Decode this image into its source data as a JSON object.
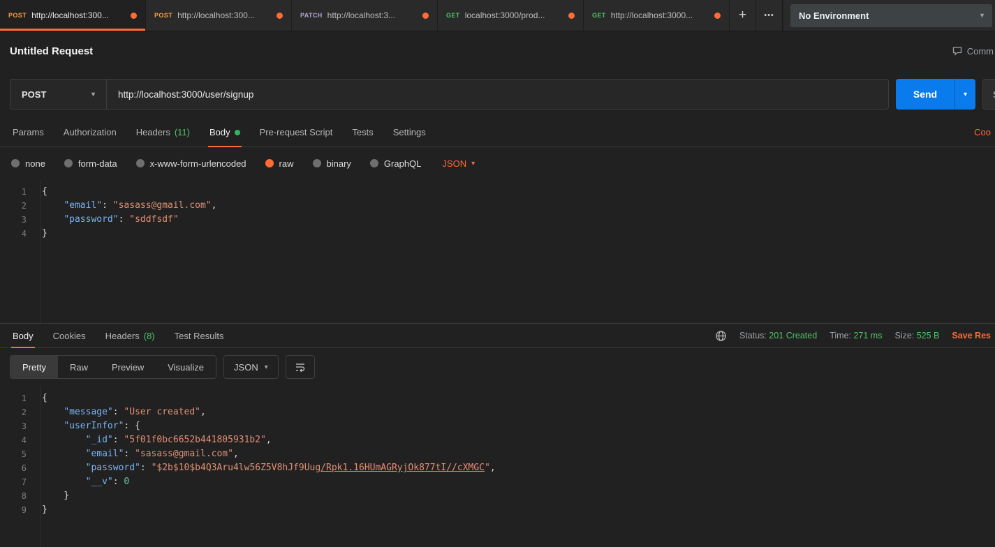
{
  "colors": {
    "accent": "#ff6c37",
    "green": "#4fc368",
    "blue": "#097bed",
    "methods": {
      "GET": "#4fc368",
      "POST": "#f59b42",
      "PATCH": "#b5a1d6"
    }
  },
  "icons": {
    "new_tab": "+",
    "more_tabs": "•••",
    "chevron_down": "▾"
  },
  "top_bar": {
    "tabs": [
      {
        "method": "POST",
        "title": "http://localhost:300...",
        "active": true,
        "unsaved": true
      },
      {
        "method": "POST",
        "title": "http://localhost:300...",
        "active": false,
        "unsaved": true
      },
      {
        "method": "PATCH",
        "title": "http://localhost:3...",
        "active": false,
        "unsaved": true
      },
      {
        "method": "GET",
        "title": "localhost:3000/prod...",
        "active": false,
        "unsaved": true
      },
      {
        "method": "GET",
        "title": "http://localhost:3000...",
        "active": false,
        "unsaved": true
      }
    ],
    "environment": {
      "selected": "No Environment"
    }
  },
  "request": {
    "title": "Untitled Request",
    "comment_label": "Comm",
    "method": "POST",
    "url": "http://localhost:3000/user/signup",
    "send_label": "Send",
    "save_label": "S",
    "cookies_label": "Coo",
    "language": "JSON",
    "nav_tabs": [
      {
        "label": "Params"
      },
      {
        "label": "Authorization"
      },
      {
        "label": "Headers",
        "count": "(11)"
      },
      {
        "label": "Body",
        "active": true,
        "dot": true
      },
      {
        "label": "Pre-request Script"
      },
      {
        "label": "Tests"
      },
      {
        "label": "Settings"
      }
    ],
    "body_modes": [
      {
        "label": "none"
      },
      {
        "label": "form-data"
      },
      {
        "label": "x-www-form-urlencoded"
      },
      {
        "label": "raw",
        "selected": true
      },
      {
        "label": "binary"
      },
      {
        "label": "GraphQL"
      }
    ],
    "editor_lines": [
      {
        "segs": [
          {
            "t": "{",
            "c": "punc"
          }
        ]
      },
      {
        "segs": [
          {
            "t": "    ",
            "c": "plain"
          },
          {
            "t": "\"email\"",
            "c": "key"
          },
          {
            "t": ": ",
            "c": "punc"
          },
          {
            "t": "\"sasass@gmail.com\"",
            "c": "str"
          },
          {
            "t": ",",
            "c": "punc"
          }
        ]
      },
      {
        "segs": [
          {
            "t": "    ",
            "c": "plain"
          },
          {
            "t": "\"password\"",
            "c": "key"
          },
          {
            "t": ": ",
            "c": "punc"
          },
          {
            "t": "\"sddfsdf\"",
            "c": "str"
          }
        ]
      },
      {
        "segs": [
          {
            "t": "}",
            "c": "punc"
          }
        ]
      }
    ]
  },
  "response": {
    "nav_tabs": [
      {
        "label": "Body",
        "active": true
      },
      {
        "label": "Cookies"
      },
      {
        "label": "Headers",
        "count": "(8)"
      },
      {
        "label": "Test Results"
      }
    ],
    "meta": [
      {
        "label": "Status:",
        "value": "201 Created"
      },
      {
        "label": "Time:",
        "value": "271 ms"
      },
      {
        "label": "Size:",
        "value": "525 B"
      }
    ],
    "save_label": "Save Res",
    "language": "JSON",
    "view_modes": [
      {
        "label": "Pretty",
        "active": true
      },
      {
        "label": "Raw"
      },
      {
        "label": "Preview"
      },
      {
        "label": "Visualize"
      }
    ],
    "editor_lines": [
      {
        "segs": [
          {
            "t": "{",
            "c": "punc"
          }
        ]
      },
      {
        "segs": [
          {
            "t": "    ",
            "c": "plain"
          },
          {
            "t": "\"message\"",
            "c": "key"
          },
          {
            "t": ": ",
            "c": "punc"
          },
          {
            "t": "\"User created\"",
            "c": "str"
          },
          {
            "t": ",",
            "c": "punc"
          }
        ]
      },
      {
        "segs": [
          {
            "t": "    ",
            "c": "plain"
          },
          {
            "t": "\"userInfor\"",
            "c": "key"
          },
          {
            "t": ": {",
            "c": "punc"
          }
        ]
      },
      {
        "segs": [
          {
            "t": "        ",
            "c": "plain"
          },
          {
            "t": "\"_id\"",
            "c": "key"
          },
          {
            "t": ": ",
            "c": "punc"
          },
          {
            "t": "\"5f01f0bc6652b441805931b2\"",
            "c": "str"
          },
          {
            "t": ",",
            "c": "punc"
          }
        ]
      },
      {
        "segs": [
          {
            "t": "        ",
            "c": "plain"
          },
          {
            "t": "\"email\"",
            "c": "key"
          },
          {
            "t": ": ",
            "c": "punc"
          },
          {
            "t": "\"sasass@gmail.com\"",
            "c": "str"
          },
          {
            "t": ",",
            "c": "punc"
          }
        ]
      },
      {
        "segs": [
          {
            "t": "        ",
            "c": "plain"
          },
          {
            "t": "\"password\"",
            "c": "key"
          },
          {
            "t": ": ",
            "c": "punc"
          },
          {
            "t": "\"$2b$10$b4Q3Aru4lw56Z5V8hJf9Uug",
            "c": "str"
          },
          {
            "t": "/Rpk1.16HUmAGRyjOk877tI//cXMGC",
            "c": "str link"
          },
          {
            "t": "\"",
            "c": "str"
          },
          {
            "t": ",",
            "c": "punc"
          }
        ]
      },
      {
        "segs": [
          {
            "t": "        ",
            "c": "plain"
          },
          {
            "t": "\"__v\"",
            "c": "key"
          },
          {
            "t": ": ",
            "c": "punc"
          },
          {
            "t": "0",
            "c": "num"
          }
        ]
      },
      {
        "segs": [
          {
            "t": "    }",
            "c": "punc"
          }
        ]
      },
      {
        "segs": [
          {
            "t": "}",
            "c": "punc"
          }
        ]
      }
    ]
  }
}
